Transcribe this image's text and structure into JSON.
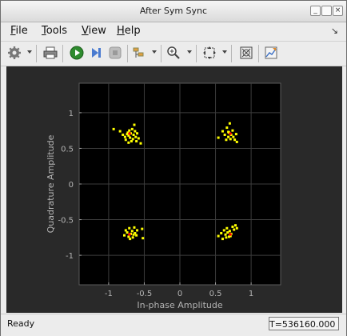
{
  "window": {
    "title": "After Sym Sync"
  },
  "menu": {
    "items": [
      {
        "label": "File",
        "mnemonic": "F",
        "rest": "ile"
      },
      {
        "label": "Tools",
        "mnemonic": "T",
        "rest": "ools"
      },
      {
        "label": "View",
        "mnemonic": "V",
        "rest": "iew"
      },
      {
        "label": "Help",
        "mnemonic": "H",
        "rest": "elp"
      }
    ]
  },
  "toolbar": {
    "icons": [
      "gear-icon",
      "print-icon",
      "run-icon",
      "step-icon",
      "stop-icon",
      "highlight-icon",
      "zoom-in-icon",
      "fit-icon",
      "scale-icon",
      "edit-icon"
    ]
  },
  "status": {
    "left": "Ready",
    "right": "T=536160.000"
  },
  "colors": {
    "axes_bg": "#000000",
    "figure_bg": "#292929",
    "points": "#ffff00",
    "ideal": "#ff0000",
    "axis_text": "#b4b4b4"
  },
  "chart_data": {
    "type": "scatter",
    "xlabel": "In-phase Amplitude",
    "ylabel": "Quadrature Amplitude",
    "xlim": [
      -1.414,
      1.414
    ],
    "ylim": [
      -1.414,
      1.414
    ],
    "xticks": [
      -1,
      -0.5,
      0,
      0.5,
      1
    ],
    "xtick_labels": [
      "-1",
      "-0.5",
      "0",
      "0.5",
      "1"
    ],
    "yticks": [
      1,
      0.5,
      0,
      -0.5,
      -1
    ],
    "ytick_labels": [
      "1",
      "0.5",
      "0",
      "-0.5",
      "-1"
    ],
    "grid": true,
    "reference_points": [
      {
        "x": -0.707,
        "y": 0.707
      },
      {
        "x": 0.707,
        "y": 0.707
      },
      {
        "x": -0.707,
        "y": -0.707
      },
      {
        "x": 0.707,
        "y": -0.707
      }
    ],
    "series": [
      {
        "values": [
          {
            "x": -0.93,
            "y": 0.77
          },
          {
            "x": -0.84,
            "y": 0.74
          },
          {
            "x": -0.8,
            "y": 0.69
          },
          {
            "x": -0.77,
            "y": 0.66
          },
          {
            "x": -0.76,
            "y": 0.62
          },
          {
            "x": -0.73,
            "y": 0.72
          },
          {
            "x": -0.72,
            "y": 0.68
          },
          {
            "x": -0.72,
            "y": 0.58
          },
          {
            "x": -0.7,
            "y": 0.65
          },
          {
            "x": -0.69,
            "y": 0.71
          },
          {
            "x": -0.67,
            "y": 0.77
          },
          {
            "x": -0.66,
            "y": 0.63
          },
          {
            "x": -0.65,
            "y": 0.69
          },
          {
            "x": -0.64,
            "y": 0.83
          },
          {
            "x": -0.63,
            "y": 0.74
          },
          {
            "x": -0.62,
            "y": 0.66
          },
          {
            "x": -0.61,
            "y": 0.6
          },
          {
            "x": -0.6,
            "y": 0.71
          },
          {
            "x": -0.58,
            "y": 0.64
          },
          {
            "x": -0.55,
            "y": 0.57
          },
          {
            "x": -0.68,
            "y": 0.6
          },
          {
            "x": -0.74,
            "y": 0.7
          },
          {
            "x": -0.71,
            "y": 0.75
          },
          {
            "x": 0.54,
            "y": 0.65
          },
          {
            "x": 0.6,
            "y": 0.74
          },
          {
            "x": 0.63,
            "y": 0.69
          },
          {
            "x": 0.65,
            "y": 0.62
          },
          {
            "x": 0.66,
            "y": 0.79
          },
          {
            "x": 0.68,
            "y": 0.66
          },
          {
            "x": 0.69,
            "y": 0.72
          },
          {
            "x": 0.7,
            "y": 0.85
          },
          {
            "x": 0.71,
            "y": 0.63
          },
          {
            "x": 0.72,
            "y": 0.69
          },
          {
            "x": 0.74,
            "y": 0.75
          },
          {
            "x": 0.75,
            "y": 0.66
          },
          {
            "x": 0.77,
            "y": 0.62
          },
          {
            "x": 0.79,
            "y": 0.7
          },
          {
            "x": 0.8,
            "y": 0.59
          },
          {
            "x": 0.68,
            "y": 0.73
          },
          {
            "x": -0.78,
            "y": -0.72
          },
          {
            "x": -0.76,
            "y": -0.65
          },
          {
            "x": -0.74,
            "y": -0.68
          },
          {
            "x": -0.72,
            "y": -0.74
          },
          {
            "x": -0.71,
            "y": -0.62
          },
          {
            "x": -0.69,
            "y": -0.7
          },
          {
            "x": -0.67,
            "y": -0.66
          },
          {
            "x": -0.66,
            "y": -0.75
          },
          {
            "x": -0.64,
            "y": -0.61
          },
          {
            "x": -0.63,
            "y": -0.69
          },
          {
            "x": -0.61,
            "y": -0.72
          },
          {
            "x": -0.6,
            "y": -0.65
          },
          {
            "x": -0.53,
            "y": -0.63
          },
          {
            "x": -0.52,
            "y": -0.76
          },
          {
            "x": -0.7,
            "y": -0.77
          },
          {
            "x": -0.65,
            "y": -0.71
          },
          {
            "x": 0.54,
            "y": -0.73
          },
          {
            "x": 0.58,
            "y": -0.69
          },
          {
            "x": 0.6,
            "y": -0.77
          },
          {
            "x": 0.62,
            "y": -0.65
          },
          {
            "x": 0.64,
            "y": -0.71
          },
          {
            "x": 0.66,
            "y": -0.62
          },
          {
            "x": 0.67,
            "y": -0.68
          },
          {
            "x": 0.69,
            "y": -0.74
          },
          {
            "x": 0.7,
            "y": -0.66
          },
          {
            "x": 0.72,
            "y": -0.7
          },
          {
            "x": 0.74,
            "y": -0.6
          },
          {
            "x": 0.76,
            "y": -0.64
          },
          {
            "x": 0.78,
            "y": -0.58
          },
          {
            "x": 0.8,
            "y": -0.62
          },
          {
            "x": 0.65,
            "y": -0.75
          },
          {
            "x": 0.71,
            "y": -0.73
          }
        ]
      }
    ]
  }
}
